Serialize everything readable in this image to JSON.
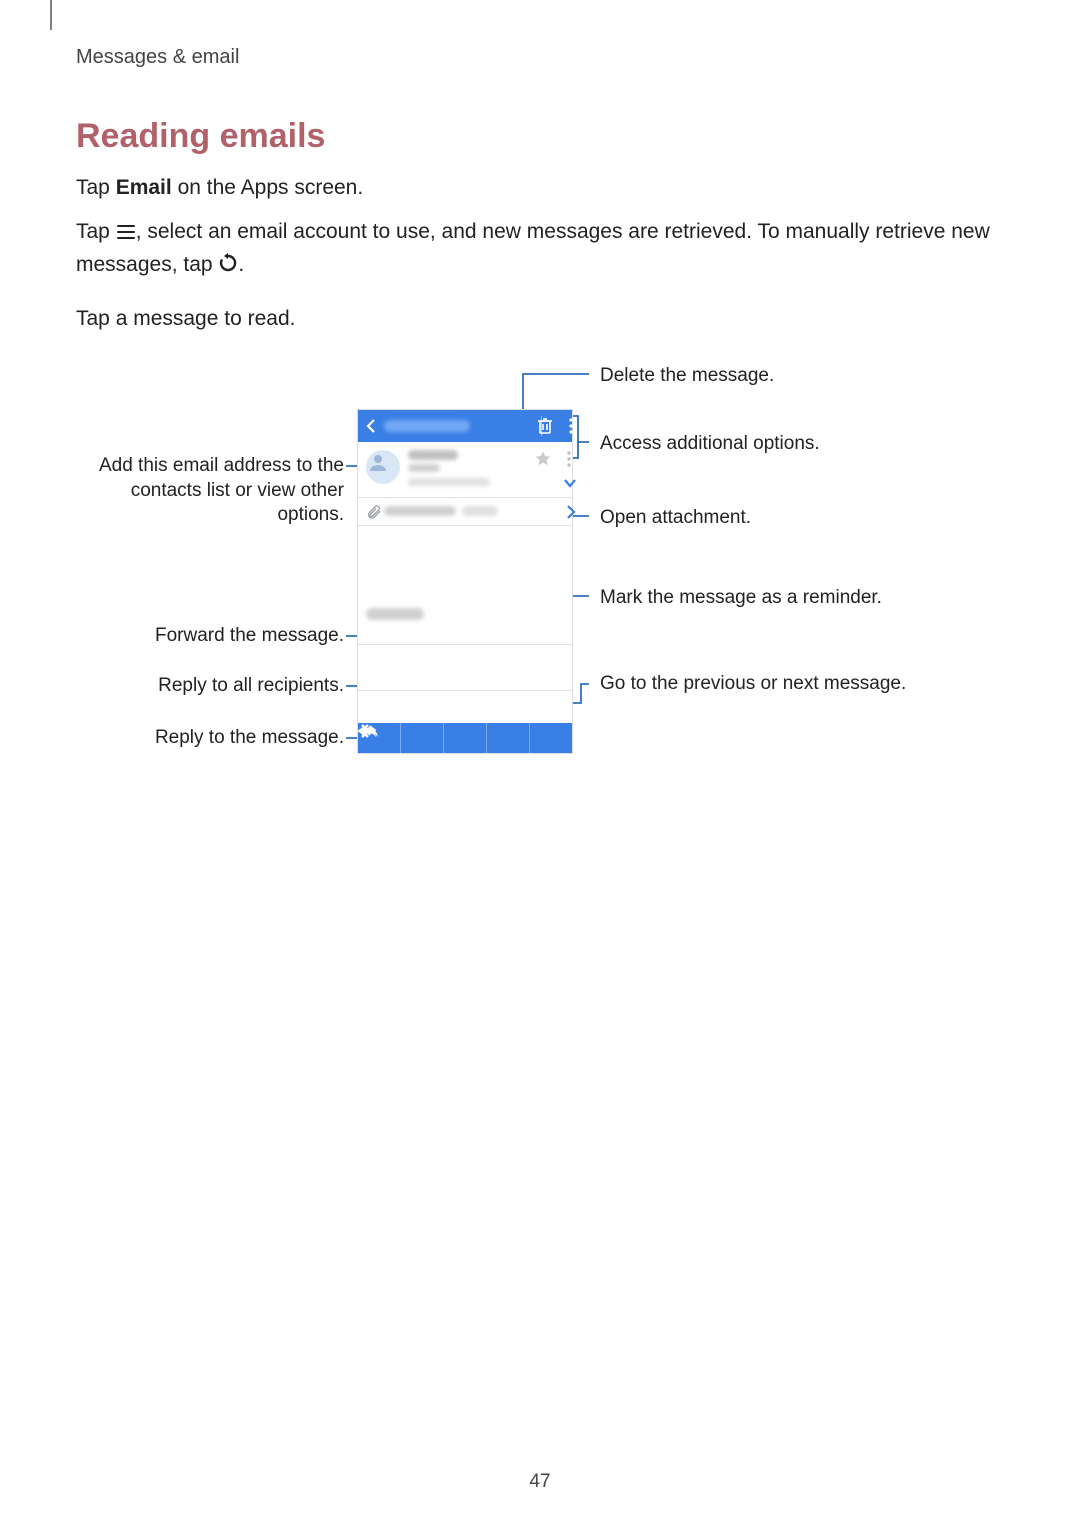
{
  "running_head": "Messages & email",
  "section_title": "Reading emails",
  "para1_pre": "Tap ",
  "para1_bold": "Email",
  "para1_post": " on the Apps screen.",
  "para2_pre": "Tap ",
  "para2_mid": ", select an email account to use, and new messages are retrieved. To manually retrieve new messages, tap ",
  "para2_end": ".",
  "para3": "Tap a message to read.",
  "callouts": {
    "delete": "Delete the message.",
    "additional": "Access additional options.",
    "add_contact": "Add this email address to the contacts list or view other options.",
    "open_attach": "Open attachment.",
    "reminder": "Mark the message as a reminder.",
    "forward": "Forward the message.",
    "reply_all": "Reply to all recipients.",
    "prev_next": "Go to the previous or next message.",
    "reply": "Reply to the message."
  },
  "page_number": "47"
}
